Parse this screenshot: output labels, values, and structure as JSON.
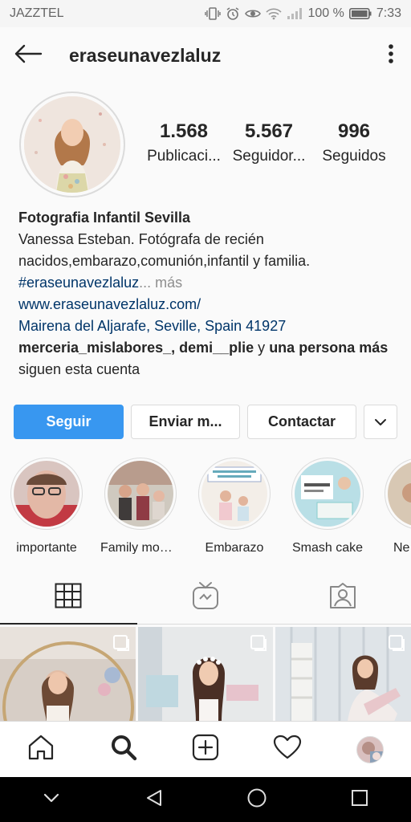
{
  "status_bar": {
    "carrier": "JAZZTEL",
    "battery": "100 %",
    "time": "7:33"
  },
  "header": {
    "username": "eraseunavezlaluz"
  },
  "profile": {
    "posts": {
      "count": "1.568",
      "label": "Publicaci..."
    },
    "followers": {
      "count": "5.567",
      "label": "Seguidor..."
    },
    "following": {
      "count": "996",
      "label": "Seguidos"
    }
  },
  "bio": {
    "name": "Fotografia Infantil Sevilla",
    "line1": "Vanessa Esteban. Fotógrafa de recién",
    "line2": "nacidos,embarazo,comunión,infantil y familia.",
    "hashtag": "#eraseunavezlaluz",
    "more": "... más",
    "website": "www.eraseunavezlaluz.com/",
    "location": "Mairena del Aljarafe, Seville, Spain 41927",
    "followed_by_accounts": "merceria_mislabores_, demi__plie",
    "followed_by_and": " y ",
    "followed_by_others": "una persona más",
    "followed_by_suffix": " siguen esta cuenta"
  },
  "actions": {
    "follow": "Seguir",
    "message": "Enviar m...",
    "contact": "Contactar"
  },
  "highlights": [
    {
      "label": "importante"
    },
    {
      "label": "Family mom..."
    },
    {
      "label": "Embarazo"
    },
    {
      "label": "Smash cake"
    },
    {
      "label": "Ne"
    }
  ],
  "colors": {
    "accent": "#3897f0",
    "link": "#003569",
    "muted": "#8e8e8e",
    "text": "#262626"
  },
  "tabs": [
    "grid-icon",
    "igtv-icon",
    "tagged-icon"
  ],
  "bottom_nav": [
    "home-icon",
    "search-icon",
    "add-post-icon",
    "heart-icon",
    "profile-avatar"
  ]
}
